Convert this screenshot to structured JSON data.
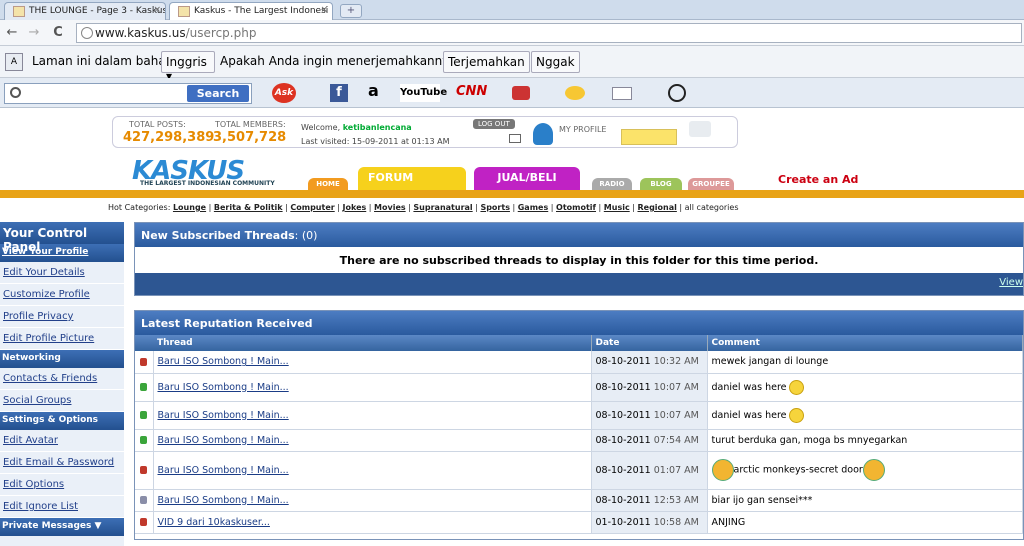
{
  "browser": {
    "tabs": [
      {
        "label": "THE LOUNGE - Page 3 - Kaskus",
        "close": "×"
      },
      {
        "label": "Kaskus - The Largest Indonesi",
        "close": "×"
      }
    ],
    "new_tab": "+",
    "back": "←",
    "forward": "→",
    "reload": "C",
    "address_domain": "www.kaskus.us",
    "address_path": "/usercp.php"
  },
  "translate_bar": {
    "text": "Laman ini dalam bahasa",
    "language": "Inggris",
    "question": "Apakah Anda ingin menerjemahkannya?",
    "translate_btn": "Terjemahkan",
    "no_btn": "Nggak"
  },
  "toolbar": {
    "search_btn": "Search",
    "ask": "Ask",
    "facebook": "f",
    "amazon": "a",
    "youtube": "YouTube",
    "cnn": "CNN",
    "dropdown": "▾"
  },
  "header": {
    "total_posts_label": "TOTAL POSTS:",
    "total_posts": "427,298,389",
    "total_members_label": "TOTAL MEMBERS:",
    "total_members": "3,507,728",
    "welcome_prefix": "Welcome,",
    "username": "ketibanlencana",
    "last_visited": "Last visited: 15-09-2011 at 01:13 AM",
    "logout": "LOG OUT",
    "my_profile": "MY PROFILE",
    "logo": "KASKUS",
    "logo_sub": "THE LARGEST INDONESIAN COMMUNITY",
    "nav": {
      "home": "HOME",
      "forum": "FORUM",
      "jual": "JUAL/BELI",
      "radio": "RADIO",
      "blog": "BLOG",
      "groupee": "GROUPEE"
    },
    "create_ad": "Create an Ad"
  },
  "hot_categories": {
    "prefix": "Hot Categories:",
    "items": [
      "Lounge",
      "Berita & Politik",
      "Computer",
      "Jokes",
      "Movies",
      "Supranatural",
      "Sports",
      "Games",
      "Otomotif",
      "Music",
      "Regional"
    ],
    "suffix": "all categories"
  },
  "sidebar": {
    "title": "Your Control Panel",
    "view_profile": "View Your Profile",
    "items1": [
      "Edit Your Details",
      "Customize Profile",
      "Profile Privacy",
      "Edit Profile Picture"
    ],
    "networking": "Networking",
    "items2": [
      "Contacts & Friends",
      "Social Groups"
    ],
    "settings": "Settings & Options",
    "items3": [
      "Edit Avatar",
      "Edit Email & Password",
      "Edit Options",
      "Edit Ignore List"
    ],
    "private_messages": "Private Messages ▼"
  },
  "subscribed": {
    "title": "New Subscribed Threads",
    "count": ": (0)",
    "message": "There are no subscribed threads to display in this folder for this time period.",
    "view_link": "View"
  },
  "reputation": {
    "title": "Latest Reputation Received",
    "columns": [
      "Thread",
      "Date",
      "Comment"
    ],
    "rows": [
      {
        "color": "#c0392b",
        "thread": "Baru ISO Sombong ! Main...",
        "date": "08-10-2011",
        "time": "10:32 AM",
        "comment": "mewek jangan di lounge",
        "emoji": ""
      },
      {
        "color": "#3aa53a",
        "thread": "Baru ISO Sombong ! Main...",
        "date": "08-10-2011",
        "time": "10:07 AM",
        "comment": "daniel was here",
        "emoji": "smile"
      },
      {
        "color": "#3aa53a",
        "thread": "Baru ISO Sombong ! Main...",
        "date": "08-10-2011",
        "time": "10:07 AM",
        "comment": "daniel was here",
        "emoji": "smile"
      },
      {
        "color": "#3aa53a",
        "thread": "Baru ISO Sombong ! Main...",
        "date": "08-10-2011",
        "time": "07:54 AM",
        "comment": "turut berduka gan, moga bs mnyegarkan",
        "emoji": ""
      },
      {
        "color": "#c0392b",
        "thread": "Baru ISO Sombong ! Main...",
        "date": "08-10-2011",
        "time": "01:07 AM",
        "comment": "arctic monkeys-secret door",
        "emoji": "avatar"
      },
      {
        "color": "#8a8ea8",
        "thread": "Baru ISO Sombong ! Main...",
        "date": "08-10-2011",
        "time": "12:53 AM",
        "comment": "biar ijo gan sensei***",
        "emoji": ""
      },
      {
        "color": "#c0392b",
        "thread": "VID 9 dari 10kaskuser...",
        "date": "01-10-2011",
        "time": "10:58 AM",
        "comment": "ANJING",
        "emoji": ""
      }
    ]
  }
}
